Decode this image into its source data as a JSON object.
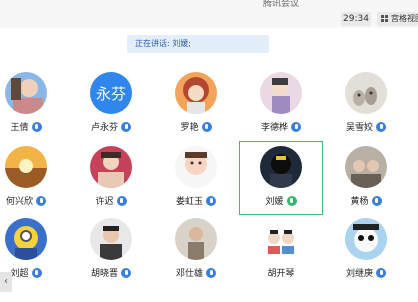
{
  "window": {
    "title": "腾讯会议"
  },
  "toolbar": {
    "timer": "29:34",
    "view_label": "宫格视图"
  },
  "speaking": {
    "label": "正在讲话: 刘媛;"
  },
  "participants": [
    {
      "name": "王倩",
      "mic": "blue-mic-icon"
    },
    {
      "name": "卢永芬",
      "mic": "blue-mic-icon",
      "avatar_text": "永芬"
    },
    {
      "name": "罗艳",
      "mic": "blue-mic-icon"
    },
    {
      "name": "李德桦",
      "mic": "blue-mic-icon"
    },
    {
      "name": "吴雪姣",
      "mic": "blue-mic-icon"
    },
    {
      "name": "何兴欣",
      "mic": "blue-mic-icon"
    },
    {
      "name": "许迟",
      "mic": "blue-mic-icon"
    },
    {
      "name": "娄虹玉",
      "mic": "blue-mic-icon"
    },
    {
      "name": "刘媛",
      "mic": "green-mic-icon",
      "active": true
    },
    {
      "name": "黄杨",
      "mic": "blue-mic-icon"
    },
    {
      "name": "刘超",
      "mic": "blue-mic-icon"
    },
    {
      "name": "胡晓晋",
      "mic": "blue-mic-icon"
    },
    {
      "name": "邓仕雄",
      "mic": "blue-mic-icon"
    },
    {
      "name": "胡开琴",
      "mic": ""
    },
    {
      "name": "刘继庚",
      "mic": "blue-mic-icon"
    }
  ],
  "colors": {
    "accent": "#3a7fe0",
    "active_border": "#3cbf6a",
    "speaking_bg": "#e4edfa"
  },
  "nav": {
    "scroll_left_icon": "‹"
  }
}
